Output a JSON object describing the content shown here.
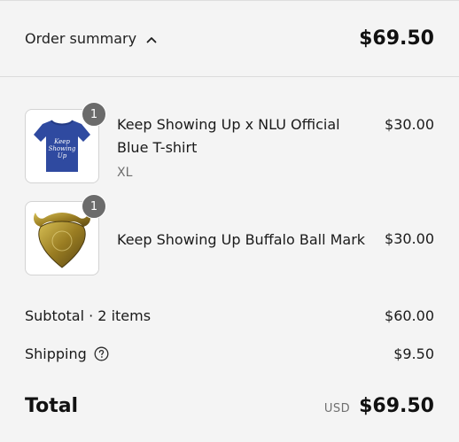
{
  "header": {
    "toggle_label": "Order summary",
    "total": "$69.50"
  },
  "items": [
    {
      "title": "Keep Showing Up x NLU Official Blue T-shirt",
      "variant": "XL",
      "price": "$30.00",
      "quantity": "1",
      "image_icon": "blue-tshirt-image",
      "image_color": "#2f4aa0"
    },
    {
      "title": "Keep Showing Up Buffalo Ball Mark",
      "variant": "",
      "price": "$30.00",
      "quantity": "1",
      "image_icon": "gold-buffalo-ball-mark-image",
      "image_color": "#b89a2f"
    }
  ],
  "totals": {
    "subtotal_label": "Subtotal · 2 items",
    "subtotal_value": "$60.00",
    "shipping_label": "Shipping",
    "shipping_value": "$9.50",
    "total_label": "Total",
    "currency": "USD",
    "total_value": "$69.50"
  }
}
